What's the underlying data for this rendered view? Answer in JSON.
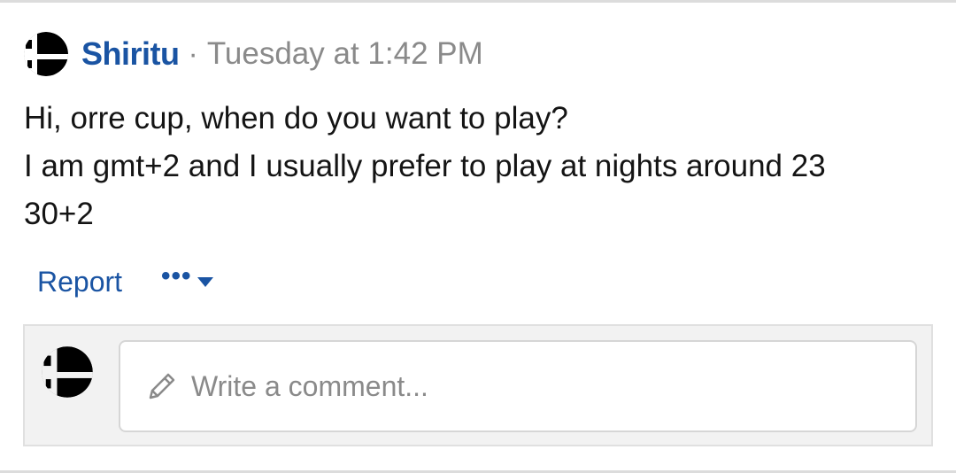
{
  "post": {
    "author": "Shiritu",
    "separator": "·",
    "timestamp": "Tuesday at 1:42 PM",
    "avatar_icon": "smash-bros-logo-icon",
    "message_lines": [
      "Hi, orre cup, when do you want to play?",
      "I am gmt+2 and I usually prefer to play at nights around 23",
      "30+2"
    ]
  },
  "actions": {
    "report_label": "Report",
    "more_label": "•••",
    "more_icon": "caret-down-icon"
  },
  "comment": {
    "avatar_icon": "smash-bros-logo-icon",
    "placeholder": "Write a comment...",
    "input_icon": "pencil-icon"
  },
  "colors": {
    "link_blue": "#1a54a3",
    "muted_gray": "#8a8a8a",
    "text": "#141414",
    "comment_bg": "#f2f2f2"
  }
}
